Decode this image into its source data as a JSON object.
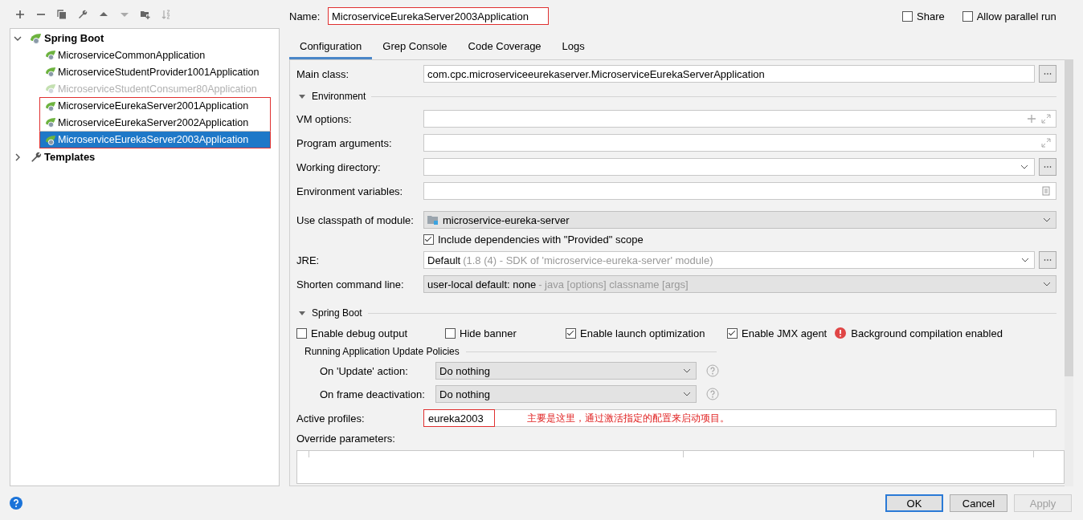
{
  "tree": [
    {
      "label": "Spring Boot",
      "expanded": true,
      "children": [
        {
          "label": "MicroserviceCommonApplication",
          "selected": false,
          "disabled": false,
          "highlighted": false
        },
        {
          "label": "MicroserviceStudentProvider1001Application",
          "selected": false,
          "disabled": false,
          "highlighted": false
        },
        {
          "label": "MicroserviceStudentConsumer80Application",
          "selected": false,
          "disabled": true,
          "highlighted": false
        },
        {
          "label": "MicroserviceEurekaServer2001Application",
          "selected": false,
          "disabled": false,
          "highlighted": true
        },
        {
          "label": "MicroserviceEurekaServer2002Application",
          "selected": false,
          "disabled": false,
          "highlighted": true
        },
        {
          "label": "MicroserviceEurekaServer2003Application",
          "selected": true,
          "disabled": false,
          "highlighted": true
        }
      ]
    },
    {
      "label": "Templates",
      "expanded": false
    }
  ],
  "name": {
    "label": "Name:",
    "value": "MicroserviceEurekaServer2003Application",
    "highlighted": true
  },
  "options": [
    {
      "label": "Share",
      "checked": false
    },
    {
      "label": "Allow parallel run",
      "checked": false
    }
  ],
  "tabs": [
    {
      "label": "Configuration",
      "selected": true
    },
    {
      "label": "Grep Console",
      "selected": false
    },
    {
      "label": "Code Coverage",
      "selected": false
    },
    {
      "label": "Logs",
      "selected": false
    }
  ],
  "main_class": {
    "label": "Main class:",
    "value": "com.cpc.microserviceeurekaserver.MicroserviceEurekaServerApplication"
  },
  "environment": {
    "title": "Environment",
    "rows": [
      {
        "kind": "options",
        "label": "VM options:"
      },
      {
        "kind": "arguments",
        "label": "Program arguments:"
      },
      {
        "kind": "directory",
        "label": "Working directory:"
      },
      {
        "kind": "variables",
        "label": "Environment variables:"
      }
    ]
  },
  "module": {
    "label": "Use classpath of module:",
    "value": "microservice-eureka-server"
  },
  "include_dependencies": {
    "label": "Include dependencies with \"Provided\" scope",
    "checked": true
  },
  "jre": {
    "label": "JRE:",
    "value": "Default",
    "hint": "(1.8 (4) - SDK of 'microservice-eureka-server' module)"
  },
  "shorten": {
    "label": "Shorten command line:",
    "value": "user-local default: none",
    "hint": "- java [options] classname [args]"
  },
  "spring_boot": {
    "title": "Spring Boot",
    "checks": [
      {
        "kind": "checkbox",
        "label": "Enable debug output",
        "checked": false
      },
      {
        "kind": "checkbox",
        "label": "Hide banner",
        "checked": false
      },
      {
        "kind": "checkbox",
        "label": "Enable launch optimization",
        "checked": true
      },
      {
        "kind": "checkbox",
        "label": "Enable JMX agent",
        "checked": true
      },
      {
        "kind": "warning",
        "label": "Background compilation enabled"
      }
    ],
    "policies": {
      "title": "Running Application Update Policies",
      "rows": [
        {
          "label": "On 'Update' action:",
          "value": "Do nothing"
        },
        {
          "label": "On frame deactivation:",
          "value": "Do nothing"
        }
      ]
    }
  },
  "active_profiles": {
    "label": "Active profiles:",
    "value": "eureka2003",
    "highlighted": true,
    "annotation": "主要是这里，通过激活指定的配置来启动项目。"
  },
  "override": {
    "label": "Override parameters:"
  },
  "buttons": [
    {
      "label": "OK",
      "kind": "default",
      "disabled": false
    },
    {
      "label": "Cancel",
      "kind": "normal",
      "disabled": false
    },
    {
      "label": "Apply",
      "kind": "normal",
      "disabled": true
    }
  ]
}
